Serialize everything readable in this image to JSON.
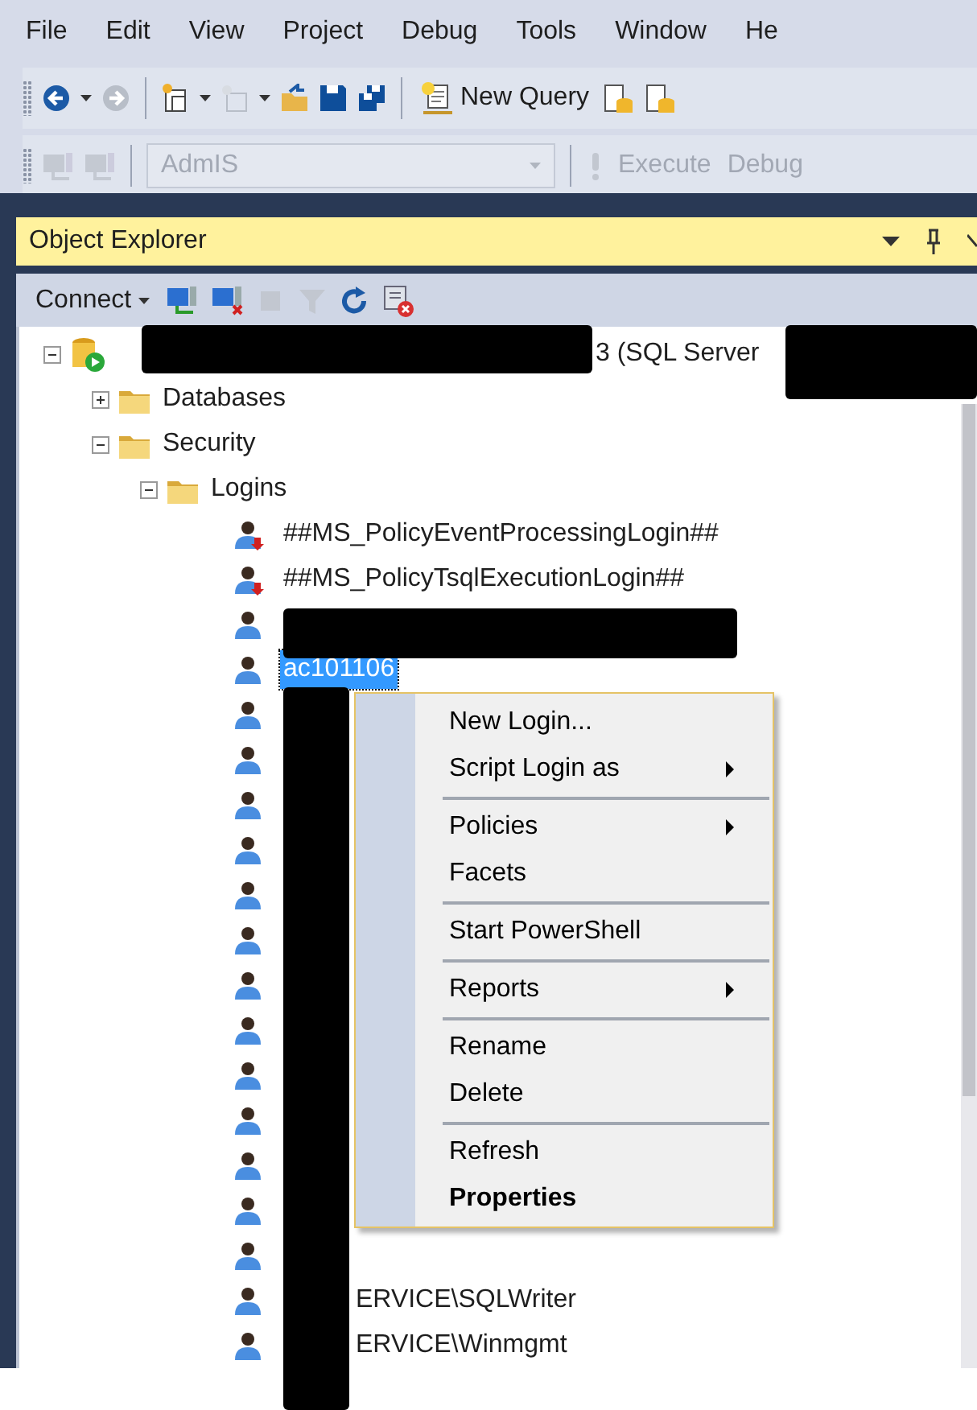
{
  "menu_bar": [
    {
      "label": "File"
    },
    {
      "label": "Edit"
    },
    {
      "label": "View"
    },
    {
      "label": "Project"
    },
    {
      "label": "Debug"
    },
    {
      "label": "Tools"
    },
    {
      "label": "Window"
    },
    {
      "label": "He"
    }
  ],
  "toolbar": {
    "new_query": {
      "label": "New Query"
    },
    "database_combo": {
      "value": "AdmIS",
      "disabled": true
    },
    "buttons": [
      {
        "label": "Execute",
        "disabled": true
      },
      {
        "label": "Debug",
        "disabled": true
      }
    ]
  },
  "object_explorer": {
    "title": "Object Explorer",
    "connect": {
      "label": "Connect"
    },
    "tree": [
      {
        "kind": "server",
        "label": "3 (SQL Server",
        "expanded": true,
        "children": [
          {
            "kind": "folder",
            "label": "Databases",
            "expanded": false
          },
          {
            "kind": "folder",
            "label": "Security",
            "expanded": true,
            "children": [
              {
                "kind": "folder",
                "label": "Logins",
                "expanded": true,
                "children": [
                  {
                    "kind": "system_login",
                    "label": "##MS_PolicyEventProcessingLogin##",
                    "selected": false
                  },
                  {
                    "kind": "system_login",
                    "label": "##MS_PolicyTsqlExecutionLogin##",
                    "selected": false
                  },
                  {
                    "kind": "login",
                    "selected": false
                  },
                  {
                    "kind": "login",
                    "label": "ac101106",
                    "selected": true
                  },
                  {
                    "kind": "login",
                    "selected": false
                  },
                  {
                    "kind": "login",
                    "selected": false
                  },
                  {
                    "kind": "login",
                    "selected": false
                  },
                  {
                    "kind": "login",
                    "selected": false
                  },
                  {
                    "kind": "login",
                    "selected": false
                  },
                  {
                    "kind": "login",
                    "selected": false
                  },
                  {
                    "kind": "login",
                    "selected": false
                  },
                  {
                    "kind": "login",
                    "selected": false
                  },
                  {
                    "kind": "login",
                    "selected": false
                  },
                  {
                    "kind": "login",
                    "selected": false
                  },
                  {
                    "kind": "login",
                    "selected": false
                  },
                  {
                    "kind": "login",
                    "selected": false
                  },
                  {
                    "kind": "login",
                    "selected": false
                  },
                  {
                    "kind": "login",
                    "label": "ERVICE\\SQLWriter",
                    "selected": false
                  },
                  {
                    "kind": "login",
                    "label": "ERVICE\\Winmgmt",
                    "selected": false
                  }
                ]
              }
            ]
          }
        ]
      }
    ]
  },
  "context_menu": {
    "items": [
      {
        "kind": "item",
        "label": "New Login...",
        "submenu": false,
        "default": false
      },
      {
        "kind": "item",
        "label": "Script Login as",
        "submenu": true,
        "default": false
      },
      {
        "kind": "separator"
      },
      {
        "kind": "item",
        "label": "Policies",
        "submenu": true,
        "default": false
      },
      {
        "kind": "item",
        "label": "Facets",
        "submenu": false,
        "default": false
      },
      {
        "kind": "separator"
      },
      {
        "kind": "item",
        "label": "Start PowerShell",
        "submenu": false,
        "default": false
      },
      {
        "kind": "separator"
      },
      {
        "kind": "item",
        "label": "Reports",
        "submenu": true,
        "default": false
      },
      {
        "kind": "separator"
      },
      {
        "kind": "item",
        "label": "Rename",
        "submenu": false,
        "default": false
      },
      {
        "kind": "item",
        "label": "Delete",
        "submenu": false,
        "default": false
      },
      {
        "kind": "separator"
      },
      {
        "kind": "item",
        "label": "Refresh",
        "submenu": false,
        "default": false
      },
      {
        "kind": "item",
        "label": "Properties",
        "submenu": false,
        "default": true
      }
    ]
  }
}
